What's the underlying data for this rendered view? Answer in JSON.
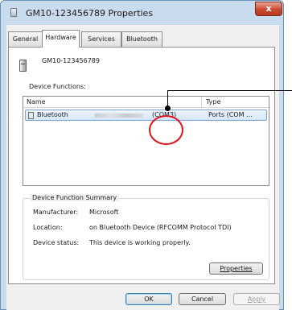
{
  "window": {
    "title": "GM10-123456789 Properties",
    "close_glyph": "x"
  },
  "tabs": [
    {
      "label": "General"
    },
    {
      "label": "Hardware"
    },
    {
      "label": "Services"
    },
    {
      "label": "Bluetooth"
    }
  ],
  "active_tab": "Hardware",
  "device": {
    "name": "GM10-123456789",
    "icon": "device-icon"
  },
  "functions": {
    "heading": "Device Functions:",
    "columns": [
      "Name",
      "Type"
    ],
    "rows": [
      {
        "name": "Bluetooth",
        "port": "(COM3)",
        "type": "Ports (COM ...",
        "icon": "port-icon",
        "selected": true
      }
    ]
  },
  "summary": {
    "title": "Device Function Summary",
    "manufacturer_label": "Manufacturer:",
    "manufacturer": "Microsoft",
    "location_label": "Location:",
    "location": "on Bluetooth Device (RFCOMM Protocol TDI)",
    "status_label": "Device status:",
    "status": "This device is working properly.",
    "properties_button": "Properties"
  },
  "buttons": {
    "ok": "OK",
    "cancel": "Cancel",
    "apply": "Apply"
  },
  "annotation": {
    "highlight_color": "#e0141a"
  }
}
